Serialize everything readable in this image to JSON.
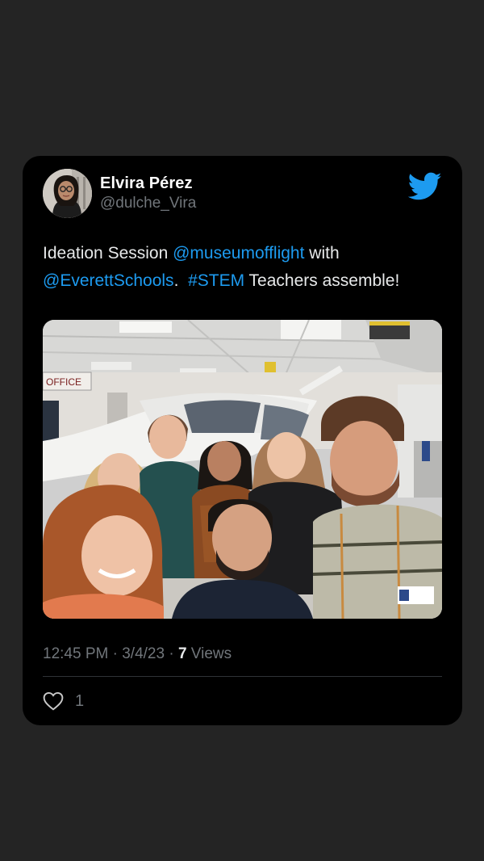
{
  "tweet": {
    "author": {
      "display_name": "Elvira Pérez",
      "handle": "@dulche_Vira",
      "avatar_icon": "avatar-photo"
    },
    "brand_icon": "twitter-bird-icon",
    "brand_color": "#1d9bf0",
    "text_parts": [
      {
        "text": "Ideation Session ",
        "type": "text"
      },
      {
        "text": "@museumofflight",
        "type": "mention"
      },
      {
        "text": " with ",
        "type": "text"
      },
      {
        "text": "@EverettSchools",
        "type": "mention"
      },
      {
        "text": ".  ",
        "type": "text"
      },
      {
        "text": "#STEM",
        "type": "hashtag"
      },
      {
        "text": " Teachers assemble!",
        "type": "text"
      }
    ],
    "photo_signage": "OFFICE",
    "time": "12:45 PM",
    "separator": " · ",
    "date": "3/4/23",
    "views_count": "7",
    "views_label": "Views",
    "likes_count": "1",
    "like_icon": "heart-icon"
  },
  "colors": {
    "page_background": "#242424",
    "card_background": "#000000",
    "text_primary": "#e7e9ea",
    "text_secondary": "#71767b",
    "link": "#1d9bf0"
  }
}
